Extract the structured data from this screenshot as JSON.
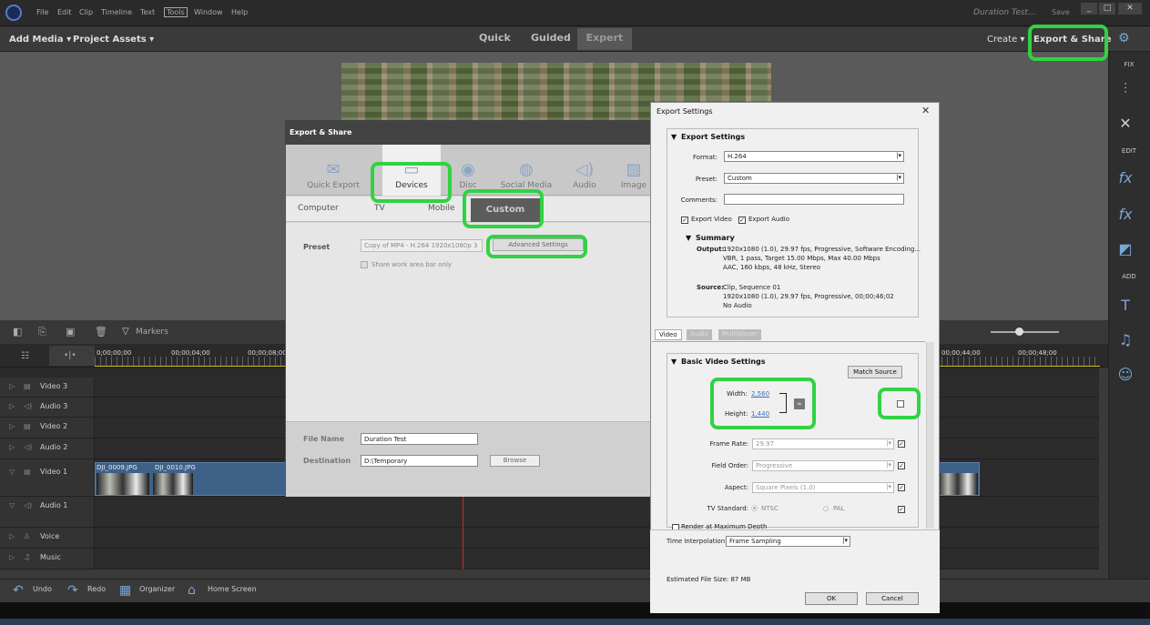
{
  "titlebar": {
    "menu": [
      "File",
      "Edit",
      "Clip",
      "Timeline",
      "Text",
      "Tools",
      "Window",
      "Help"
    ],
    "doc_title": "Duration Test...",
    "save": "Save",
    "minimize": "_",
    "maximize": "□",
    "close": "✕"
  },
  "toolbar": {
    "add_media": "Add Media ▾",
    "project_assets": "Project Assets ▾",
    "modes": [
      "Quick",
      "Guided",
      "Expert"
    ],
    "create": "Create ▾",
    "export_share": "Export & Share"
  },
  "right_panel": {
    "fix": "FIX",
    "edit": "EDIT",
    "add": "ADD"
  },
  "timeline": {
    "markers": "Markers",
    "timecodes": [
      "0;00;00;00",
      "00;00;04;00",
      "00;00;08;00",
      "00;00;44;00",
      "00;00;48;00"
    ],
    "tracks": [
      "Video 3",
      "Audio 3",
      "Video 2",
      "Audio 2",
      "Video 1",
      "Audio 1",
      "Voice",
      "Music"
    ],
    "clips": [
      "DJI_0009.JPG",
      "DJI_0010.JPG"
    ]
  },
  "bottom_bar": {
    "undo": "Undo",
    "redo": "Redo",
    "organizer": "Organizer",
    "home": "Home Screen"
  },
  "export_share": {
    "title": "Export & Share",
    "tabs": [
      "Quick Export",
      "Devices",
      "Disc",
      "Social Media",
      "Audio",
      "Image"
    ],
    "subtabs": [
      "Computer",
      "TV",
      "Mobile",
      "Custom"
    ],
    "preset_label": "Preset",
    "preset_value": "Copy of MP4 - H.264 1920x1080p 3",
    "advanced_settings": "Advanced Settings",
    "share_work_area": "Share work area bar only",
    "file_name_label": "File Name",
    "file_name_value": "Duration Test",
    "destination_label": "Destination",
    "destination_value": "D:\\Temporary",
    "browse": "Browse"
  },
  "export_settings": {
    "title": "Export Settings",
    "close": "✕",
    "section_export": "Export Settings",
    "format_label": "Format:",
    "format_value": "H.264",
    "preset_label": "Preset:",
    "preset_value": "Custom",
    "comments_label": "Comments:",
    "comments_value": "",
    "export_video": "Export Video",
    "export_audio": "Export Audio",
    "summary_label": "Summary",
    "output_label": "Output:",
    "output_lines": [
      "1920x1080 (1.0), 29.97 fps, Progressive, Software Encoding...",
      "VBR, 1 pass, Target 15.00 Mbps, Max 40.00 Mbps",
      "AAC, 160 kbps, 48 kHz, Stereo"
    ],
    "source_label": "Source:",
    "source_lines": [
      "Clip, Sequence 01",
      "1920x1080 (1.0), 29.97 fps, Progressive, 00;00;46;02",
      "No Audio"
    ],
    "tabs": [
      "Video",
      "Audio",
      "Multiplexer"
    ],
    "basic_video": "Basic Video Settings",
    "match_source": "Match Source",
    "width_label": "Width:",
    "width_value": "2,560",
    "height_label": "Height:",
    "height_value": "1,440",
    "frame_rate_label": "Frame Rate:",
    "frame_rate_value": "29.97",
    "field_order_label": "Field Order:",
    "field_order_value": "Progressive",
    "aspect_label": "Aspect:",
    "aspect_value": "Square Pixels (1.0)",
    "tv_standard_label": "TV Standard:",
    "ntsc": "NTSC",
    "pal": "PAL",
    "render_max": "Render at Maximum Depth",
    "time_interp_label": "Time Interpolation:",
    "time_interp_value": "Frame Sampling",
    "file_size": "Estimated File Size:  87 MB",
    "ok": "OK",
    "cancel": "Cancel"
  }
}
